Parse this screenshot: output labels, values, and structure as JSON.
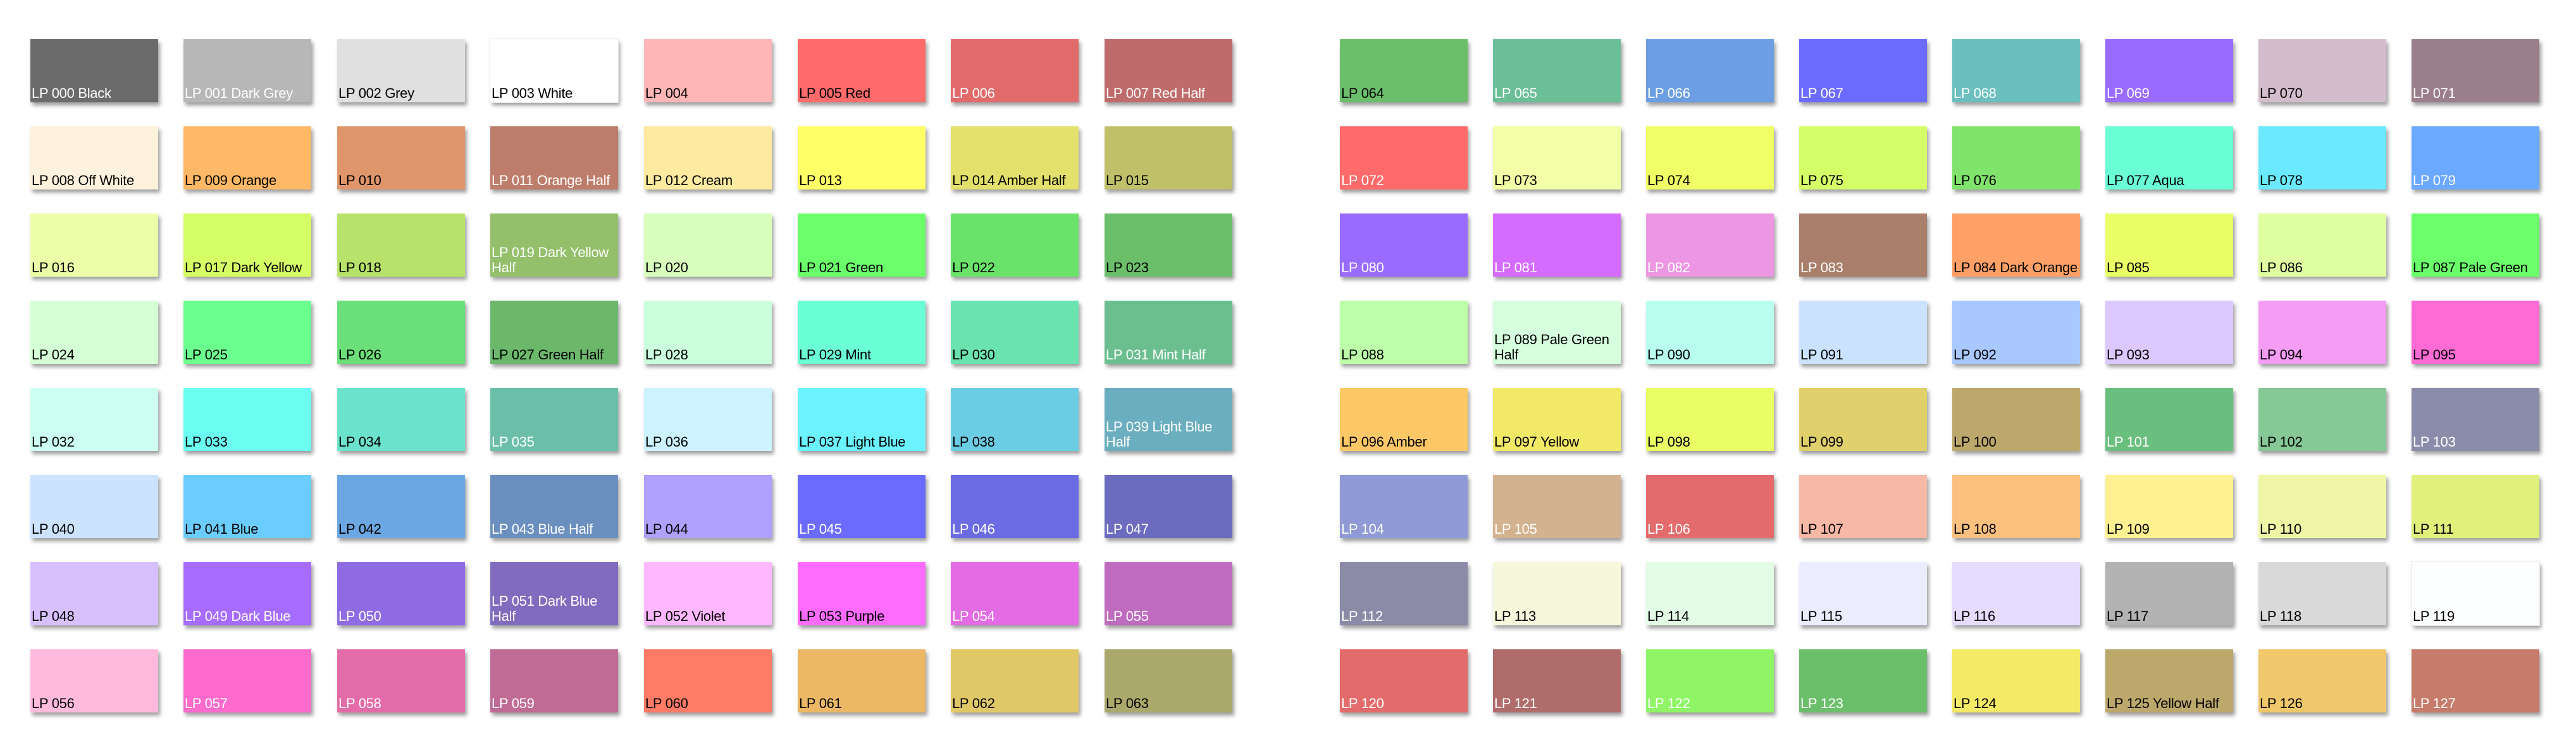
{
  "palettes": [
    {
      "swatches": [
        {
          "label": "LP 000 Black",
          "color": "#6b6b6b",
          "text": "light"
        },
        {
          "label": "LP 001 Dark Grey",
          "color": "#b7b7b7",
          "text": "light"
        },
        {
          "label": "LP 002 Grey",
          "color": "#e0e0e0",
          "text": "dark"
        },
        {
          "label": "LP 003 White",
          "color": "#ffffff",
          "text": "dark"
        },
        {
          "label": "LP 004",
          "color": "#ffb6b6",
          "text": "dark"
        },
        {
          "label": "LP 005 Red",
          "color": "#ff6b6b",
          "text": "dark"
        },
        {
          "label": "LP 006",
          "color": "#e16b6b",
          "text": "light"
        },
        {
          "label": "LP 007 Red Half",
          "color": "#c06b6b",
          "text": "light"
        },
        {
          "label": "LP 008 Off White",
          "color": "#fff2dd",
          "text": "dark"
        },
        {
          "label": "LP 009 Orange",
          "color": "#ffb866",
          "text": "dark"
        },
        {
          "label": "LP 010",
          "color": "#e0966b",
          "text": "dark"
        },
        {
          "label": "LP 011 Orange Half",
          "color": "#be7d6b",
          "text": "light"
        },
        {
          "label": "LP 012 Cream",
          "color": "#ffeba0",
          "text": "dark"
        },
        {
          "label": "LP 013",
          "color": "#ffff66",
          "text": "dark"
        },
        {
          "label": "LP 014 Amber Half",
          "color": "#e3e06b",
          "text": "dark"
        },
        {
          "label": "LP 015",
          "color": "#c0c06b",
          "text": "dark"
        },
        {
          "label": "LP 016",
          "color": "#ecffa8",
          "text": "dark"
        },
        {
          "label": "LP 017 Dark Yellow",
          "color": "#d6ff66",
          "text": "dark"
        },
        {
          "label": "LP 018",
          "color": "#b8e36b",
          "text": "dark"
        },
        {
          "label": "LP 019 Dark Yellow Half",
          "color": "#94bf6b",
          "text": "light"
        },
        {
          "label": "LP 020",
          "color": "#d9ffbc",
          "text": "dark"
        },
        {
          "label": "LP 021 Green",
          "color": "#6bff6b",
          "text": "dark"
        },
        {
          "label": "LP 022",
          "color": "#6be36b",
          "text": "dark"
        },
        {
          "label": "LP 023",
          "color": "#6bbf6b",
          "text": "dark"
        },
        {
          "label": "LP 024",
          "color": "#d5ffd5",
          "text": "dark"
        },
        {
          "label": "LP 025",
          "color": "#6bff8e",
          "text": "dark"
        },
        {
          "label": "LP 026",
          "color": "#6be07a",
          "text": "dark"
        },
        {
          "label": "LP 027 Green Half",
          "color": "#6bb86b",
          "text": "dark"
        },
        {
          "label": "LP 028",
          "color": "#ccffdd",
          "text": "dark"
        },
        {
          "label": "LP 029 Mint",
          "color": "#6bffd5",
          "text": "dark"
        },
        {
          "label": "LP 030",
          "color": "#6be3ae",
          "text": "dark"
        },
        {
          "label": "LP 031 Mint Half",
          "color": "#6bbf8f",
          "text": "light"
        },
        {
          "label": "LP 032",
          "color": "#ccfff2",
          "text": "dark"
        },
        {
          "label": "LP 033",
          "color": "#6bfff2",
          "text": "dark"
        },
        {
          "label": "LP 034",
          "color": "#6be3cc",
          "text": "dark"
        },
        {
          "label": "LP 035",
          "color": "#6bbfa8",
          "text": "light"
        },
        {
          "label": "LP 036",
          "color": "#ccf3ff",
          "text": "dark"
        },
        {
          "label": "LP 037 Light Blue",
          "color": "#6bf3ff",
          "text": "dark"
        },
        {
          "label": "LP 038",
          "color": "#6bcde3",
          "text": "dark"
        },
        {
          "label": "LP 039 Light Blue Half",
          "color": "#6baebf",
          "text": "light"
        },
        {
          "label": "LP 040",
          "color": "#cce3ff",
          "text": "dark"
        },
        {
          "label": "LP 041 Blue",
          "color": "#6bcdff",
          "text": "dark"
        },
        {
          "label": "LP 042",
          "color": "#6ba8e3",
          "text": "dark"
        },
        {
          "label": "LP 043 Blue Half",
          "color": "#6b8fbf",
          "text": "light"
        },
        {
          "label": "LP 044",
          "color": "#b0a0ff",
          "text": "dark"
        },
        {
          "label": "LP 045",
          "color": "#6b6bff",
          "text": "light"
        },
        {
          "label": "LP 046",
          "color": "#6b6be3",
          "text": "light"
        },
        {
          "label": "LP 047",
          "color": "#6b6bbf",
          "text": "light"
        },
        {
          "label": "LP 048",
          "color": "#d8c0ff",
          "text": "dark"
        },
        {
          "label": "LP 049 Dark Blue",
          "color": "#a66bff",
          "text": "light"
        },
        {
          "label": "LP 050",
          "color": "#8f6be3",
          "text": "light"
        },
        {
          "label": "LP 051 Dark Blue Half",
          "color": "#806bbf",
          "text": "light"
        },
        {
          "label": "LP 052 Violet",
          "color": "#ffb8ff",
          "text": "dark"
        },
        {
          "label": "LP 053 Purple",
          "color": "#ff6bff",
          "text": "dark"
        },
        {
          "label": "LP 054",
          "color": "#e36be3",
          "text": "light"
        },
        {
          "label": "LP 055",
          "color": "#bf6bbf",
          "text": "light"
        },
        {
          "label": "LP 056",
          "color": "#ffbadd",
          "text": "dark"
        },
        {
          "label": "LP 057",
          "color": "#ff6bcc",
          "text": "light"
        },
        {
          "label": "LP 058",
          "color": "#e36ba8",
          "text": "light"
        },
        {
          "label": "LP 059",
          "color": "#bf6b96",
          "text": "light"
        },
        {
          "label": "LP 060",
          "color": "#ff7b66",
          "text": "dark"
        },
        {
          "label": "LP 061",
          "color": "#ecb866",
          "text": "dark"
        },
        {
          "label": "LP 062",
          "color": "#e0c866",
          "text": "dark"
        },
        {
          "label": "LP 063",
          "color": "#aaa96b",
          "text": "dark"
        }
      ]
    },
    {
      "swatches": [
        {
          "label": "LP 064",
          "color": "#6bbf6b",
          "text": "dark"
        },
        {
          "label": "LP 065",
          "color": "#6bbf96",
          "text": "light"
        },
        {
          "label": "LP 066",
          "color": "#6b9ee3",
          "text": "light"
        },
        {
          "label": "LP 067",
          "color": "#6b6bff",
          "text": "light"
        },
        {
          "label": "LP 068",
          "color": "#6bbfbf",
          "text": "light"
        },
        {
          "label": "LP 069",
          "color": "#9a6bff",
          "text": "light"
        },
        {
          "label": "LP 070",
          "color": "#d3bccb",
          "text": "dark"
        },
        {
          "label": "LP 071",
          "color": "#9a7e8b",
          "text": "light"
        },
        {
          "label": "LP 072",
          "color": "#ff6b6b",
          "text": "light"
        },
        {
          "label": "LP 073",
          "color": "#f2ffa6",
          "text": "dark"
        },
        {
          "label": "LP 074",
          "color": "#f0ff66",
          "text": "dark"
        },
        {
          "label": "LP 075",
          "color": "#d5ff66",
          "text": "dark"
        },
        {
          "label": "LP 076",
          "color": "#80e36b",
          "text": "dark"
        },
        {
          "label": "LP 077 Aqua",
          "color": "#6bffd5",
          "text": "dark"
        },
        {
          "label": "LP 078",
          "color": "#6beaff",
          "text": "dark"
        },
        {
          "label": "LP 079",
          "color": "#6ba8ff",
          "text": "light"
        },
        {
          "label": "LP 080",
          "color": "#9a6bff",
          "text": "light"
        },
        {
          "label": "LP 081",
          "color": "#d66bff",
          "text": "light"
        },
        {
          "label": "LP 082",
          "color": "#ed96e3",
          "text": "light"
        },
        {
          "label": "LP 083",
          "color": "#a97e6b",
          "text": "light"
        },
        {
          "label": "LP 084 Dark Orange",
          "color": "#ffa066",
          "text": "dark"
        },
        {
          "label": "LP 085",
          "color": "#e8ff66",
          "text": "dark"
        },
        {
          "label": "LP 086",
          "color": "#dfffa0",
          "text": "dark"
        },
        {
          "label": "LP 087 Pale Green",
          "color": "#6bff6b",
          "text": "dark"
        },
        {
          "label": "LP 088",
          "color": "#bcffa8",
          "text": "dark"
        },
        {
          "label": "LP 089 Pale Green Half",
          "color": "#d5ffdd",
          "text": "dark"
        },
        {
          "label": "LP 090",
          "color": "#b8fff0",
          "text": "dark"
        },
        {
          "label": "LP 091",
          "color": "#cce3ff",
          "text": "dark"
        },
        {
          "label": "LP 092",
          "color": "#a8c8ff",
          "text": "dark"
        },
        {
          "label": "LP 093",
          "color": "#dcc8ff",
          "text": "dark"
        },
        {
          "label": "LP 094",
          "color": "#f59cf5",
          "text": "dark"
        },
        {
          "label": "LP 095",
          "color": "#ff6bd5",
          "text": "dark"
        },
        {
          "label": "LP 096 Amber",
          "color": "#ffc866",
          "text": "dark"
        },
        {
          "label": "LP 097 Yellow",
          "color": "#f2ea66",
          "text": "dark"
        },
        {
          "label": "LP 098",
          "color": "#eaff66",
          "text": "dark"
        },
        {
          "label": "LP 099",
          "color": "#e0d06b",
          "text": "dark"
        },
        {
          "label": "LP 100",
          "color": "#bda86b",
          "text": "dark"
        },
        {
          "label": "LP 101",
          "color": "#6bbf7e",
          "text": "light"
        },
        {
          "label": "LP 102",
          "color": "#86c896",
          "text": "dark"
        },
        {
          "label": "LP 103",
          "color": "#8b8baa",
          "text": "light"
        },
        {
          "label": "LP 104",
          "color": "#8f9ad6",
          "text": "light"
        },
        {
          "label": "LP 105",
          "color": "#d3b38f",
          "text": "light"
        },
        {
          "label": "LP 106",
          "color": "#e36b6b",
          "text": "light"
        },
        {
          "label": "LP 107",
          "color": "#f7b8a6",
          "text": "dark"
        },
        {
          "label": "LP 108",
          "color": "#fcc07e",
          "text": "dark"
        },
        {
          "label": "LP 109",
          "color": "#fff091",
          "text": "dark"
        },
        {
          "label": "LP 110",
          "color": "#eff7a6",
          "text": "dark"
        },
        {
          "label": "LP 111",
          "color": "#e0f07a",
          "text": "dark"
        },
        {
          "label": "LP 112",
          "color": "#8b8ba8",
          "text": "light"
        },
        {
          "label": "LP 113",
          "color": "#f7f7dc",
          "text": "dark"
        },
        {
          "label": "LP 114",
          "color": "#e3fce5",
          "text": "dark"
        },
        {
          "label": "LP 115",
          "color": "#ececff",
          "text": "dark"
        },
        {
          "label": "LP 116",
          "color": "#e5dcff",
          "text": "dark"
        },
        {
          "label": "LP 117",
          "color": "#b3b3b3",
          "text": "dark"
        },
        {
          "label": "LP 118",
          "color": "#d9d9d9",
          "text": "dark"
        },
        {
          "label": "LP 119",
          "color": "#fcfeff",
          "text": "dark"
        },
        {
          "label": "LP 120",
          "color": "#e36b6b",
          "text": "light"
        },
        {
          "label": "LP 121",
          "color": "#b06b6b",
          "text": "light"
        },
        {
          "label": "LP 122",
          "color": "#8ff566",
          "text": "light"
        },
        {
          "label": "LP 123",
          "color": "#6bbf6b",
          "text": "light"
        },
        {
          "label": "LP 124",
          "color": "#f5ea66",
          "text": "dark"
        },
        {
          "label": "LP 125 Yellow Half",
          "color": "#bda86b",
          "text": "dark"
        },
        {
          "label": "LP 126",
          "color": "#f0c86b",
          "text": "dark"
        },
        {
          "label": "LP 127",
          "color": "#c67b6b",
          "text": "light"
        }
      ]
    }
  ]
}
